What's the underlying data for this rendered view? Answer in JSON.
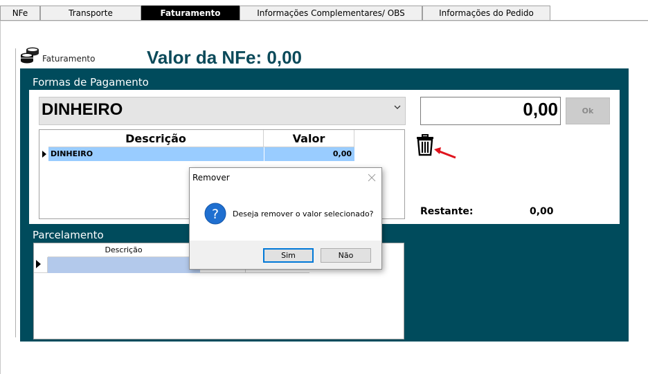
{
  "tabs": [
    {
      "label": "NFe",
      "active": false
    },
    {
      "label": "Transporte",
      "active": false
    },
    {
      "label": "Faturamento",
      "active": true
    },
    {
      "label": "Informações Complementares/ OBS",
      "active": false
    },
    {
      "label": "Informações do Pedido",
      "active": false
    }
  ],
  "header": {
    "section_label": "Faturamento",
    "valor_title": "Valor da NFe: 0,00"
  },
  "formas_pagamento": {
    "label": "Formas de Pagamento",
    "selected_option": "DINHEIRO",
    "value_input": "0,00",
    "ok_label": "Ok",
    "table": {
      "columns": [
        "Descrição",
        "Valor"
      ],
      "rows": [
        {
          "descricao": "DINHEIRO",
          "valor": "0,00"
        }
      ]
    },
    "restante_label": "Restante:",
    "restante_value": "0,00"
  },
  "parcelamento": {
    "label": "Parcelamento",
    "columns": [
      "Descrição"
    ]
  },
  "dialog": {
    "title": "Remover",
    "message": "Deseja remover o valor selecionado?",
    "yes_label": "Sim",
    "no_label": "Não"
  },
  "colors": {
    "panel_teal": "#004b5c",
    "title_teal": "#0b4a5a",
    "selected_row": "#99ccff",
    "arrow_red": "#e0141e"
  },
  "icons": {
    "coins": "coins-icon",
    "trash": "trash-icon",
    "arrow": "red-arrow-icon",
    "question": "question-icon",
    "close": "close-icon",
    "dropdown": "chevron-down-icon"
  }
}
